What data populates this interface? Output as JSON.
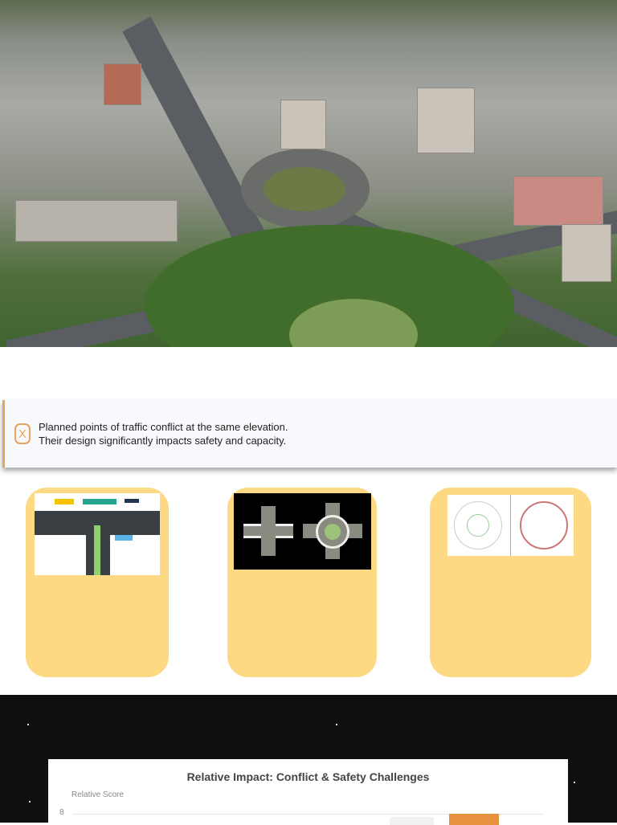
{
  "callout": {
    "icon": "octagon-x-icon",
    "icon_glyph": "X",
    "line1": "Planned points of traffic conflict at the same elevation.",
    "line2": "Their design significantly impacts safety and capacity."
  },
  "cards": [
    {
      "image": "t-intersection-diagram"
    },
    {
      "image": "intersection-vs-roundabout"
    },
    {
      "image": "roundabout-conflict-diagrams"
    }
  ],
  "colors": {
    "accent": "#e8a45a",
    "card": "#fcd982",
    "bar": "#e8913f"
  },
  "chart_data": {
    "type": "bar",
    "title": "Relative Impact: Conflict & Safety Challenges",
    "ylabel": "Relative Score",
    "yticks": [
      "8"
    ],
    "ylim": [
      0,
      8
    ],
    "categories": [],
    "values": []
  }
}
